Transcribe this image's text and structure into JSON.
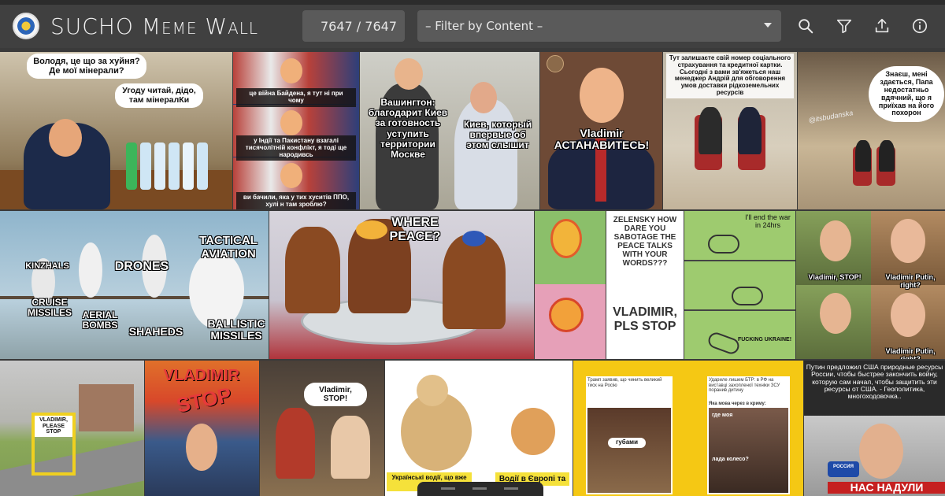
{
  "header": {
    "title_prefix": "SUCHO ",
    "title_main": "Meme Wall",
    "counter": "7647 / 7647",
    "filter_placeholder": "– Filter by Content –"
  },
  "icons": [
    "search-icon",
    "filter-icon",
    "upload-icon",
    "info-icon"
  ],
  "memes": {
    "m1": {
      "top": "Володя, це що за хуйня? Де мої мінерали?",
      "right": "Угоду читай, дідо, там мінералКи"
    },
    "m2": {
      "c1": "це війна Байдена, я тут ні при чому",
      "c2": "у Індії та Пакистану взагалі тисячолітній конфлікт, я тоді ще народивсь",
      "c3": "ви бачили, яка у тих хуситів ППО, хулі н там зроблю?"
    },
    "m3": {
      "left": "Вашингтон: благодарит Киев за готовность уступить территории Москве",
      "right": "Киев, который впервые об этом слышит"
    },
    "m4": {
      "text": "Vladimir АСТАНАВИТЕСЬ!"
    },
    "m5": {
      "text": "Тут залишаєте свій номер соціального страхування та кредитної картки. Сьогодні з вами зв'яжеться наш менеджер Андрій для обговорення умов доставки рідкоземельних ресурсів"
    },
    "m6": {
      "bubble": "Знаєш, мені здається, Папа недостатньо вдячний, що я приїхав на його похорон",
      "watermark": "@itsbudanska"
    },
    "m7": {
      "l1": "KINZHALS",
      "l2": "DRONES",
      "l3": "TACTICAL AVIATION",
      "l4": "CRUISE MISSILES",
      "l5": "AERIAL BOMBS",
      "l6": "SHAHEDS",
      "l7": "BALLISTIC MISSILES"
    },
    "m8": {
      "text": "WHERE PEACE?"
    },
    "m9": {
      "t1": "ZELENSKY HOW DARE YOU SABOTAGE THE PEACE TALKS WITH YOUR WORDS???",
      "t2": "VLADIMIR, PLS STOP"
    },
    "m10": {
      "t1": "I'll end the war in 24hrs",
      "t2": "FUCKING UKRAINE!"
    },
    "m11": {
      "t1": "Vladimir, STOP!",
      "t2": "Vladimir Putin, right?",
      "t3": "Vladimir Putin, right?"
    },
    "m12": {
      "sign": "VLADIMIR, PLEASE STOP"
    },
    "m13": {
      "t1": "VLADIMIR",
      "t2": "STOP"
    },
    "m14": {
      "text": "Vladimir, STOP!"
    },
    "m15": {
      "t1": "Українські водії, що вже дію в",
      "t2": "Водії в Європі та"
    },
    "m16": {
      "t1": "Трамп заявив, що чинить великий тиск на Росію",
      "t2": "Удариле лишем БТР: в РФ на виставці захопленої техніки ЗСУ поранив дитину",
      "t3": "Яка мова через в криму:",
      "t4": "где моя",
      "t5": "губами",
      "t6": "лада колесо?"
    },
    "m17": {
      "t1": "Путин предложил США природные ресурсы России, чтобы быстрее закончить войну, которую сам начал, чтобы защитить эти ресурсы от США. - Геополитика, многоходовочка..",
      "t2": "НАС НАДУЛИ",
      "t3": "РОССИЯ"
    }
  }
}
